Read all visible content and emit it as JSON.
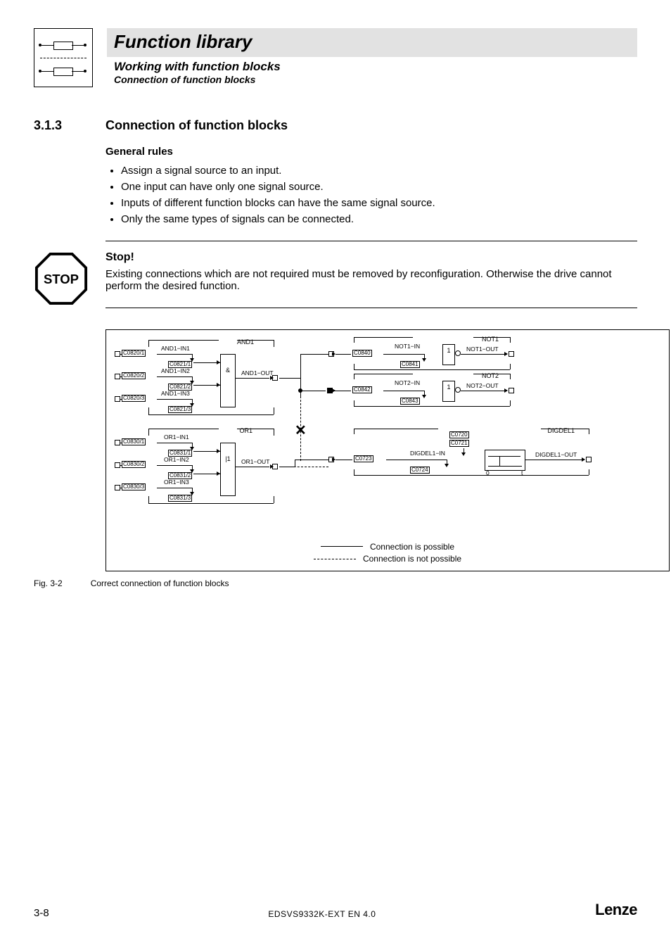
{
  "header": {
    "title": "Function library",
    "sub1": "Working with function blocks",
    "sub2": "Connection of function blocks"
  },
  "section": {
    "num": "3.1.3",
    "title": "Connection of function blocks",
    "subhead": "General rules",
    "bullets": [
      "Assign a signal source to an input.",
      "One input can have only one signal source.",
      "Inputs of different function blocks can have the same signal source.",
      "Only the same types of signals can be connected."
    ]
  },
  "stop": {
    "label": "STOP",
    "title": "Stop!",
    "text": "Existing connections which are not required must be removed by reconfiguration. Otherwise the drive cannot perform the desired function."
  },
  "diagram": {
    "blocks": {
      "and1": {
        "name": "AND1",
        "gate": "&",
        "out": "AND1−OUT",
        "ports": [
          {
            "label": "AND1−IN1",
            "selCode": "C0820/1",
            "valCode": "C0821/1"
          },
          {
            "label": "AND1−IN2",
            "selCode": "C0820/2",
            "valCode": "C0821/2"
          },
          {
            "label": "AND1−IN3",
            "selCode": "C0820/3",
            "valCode": "C0821/3"
          }
        ]
      },
      "or1": {
        "name": "OR1",
        "gate": "|1",
        "out": "OR1−OUT",
        "ports": [
          {
            "label": "OR1−IN1",
            "selCode": "C0830/1",
            "valCode": "C0831/1"
          },
          {
            "label": "OR1−IN2",
            "selCode": "C0830/2",
            "valCode": "C0831/2"
          },
          {
            "label": "OR1−IN3",
            "selCode": "C0830/3",
            "valCode": "C0831/3"
          }
        ]
      },
      "not1": {
        "name": "NOT1",
        "gate": "1",
        "inLabel": "NOT1−IN",
        "outLabel": "NOT1−OUT",
        "selCode": "C0840",
        "valCode": "C0841"
      },
      "not2": {
        "name": "NOT2",
        "gate": "1",
        "inLabel": "NOT2−IN",
        "outLabel": "NOT2−OUT",
        "selCode": "C0842",
        "valCode": "C0843"
      },
      "digdel1": {
        "name": "DIGDEL1",
        "inLabel": "DIGDEL1−IN",
        "outLabel": "DIGDEL1−OUT",
        "selCode": "C0723",
        "valCode": "C0724",
        "topCodes": [
          "C0720",
          "C0721"
        ],
        "axis0": "0",
        "axisT": "t"
      }
    },
    "legend": {
      "ok": "Connection is possible",
      "no": "Connection is not possible"
    }
  },
  "figure": {
    "num": "Fig. 3-2",
    "caption": "Correct connection of function blocks"
  },
  "footer": {
    "page": "3-8",
    "docid": "EDSVS9332K-EXT EN 4.0",
    "brand": "Lenze"
  }
}
